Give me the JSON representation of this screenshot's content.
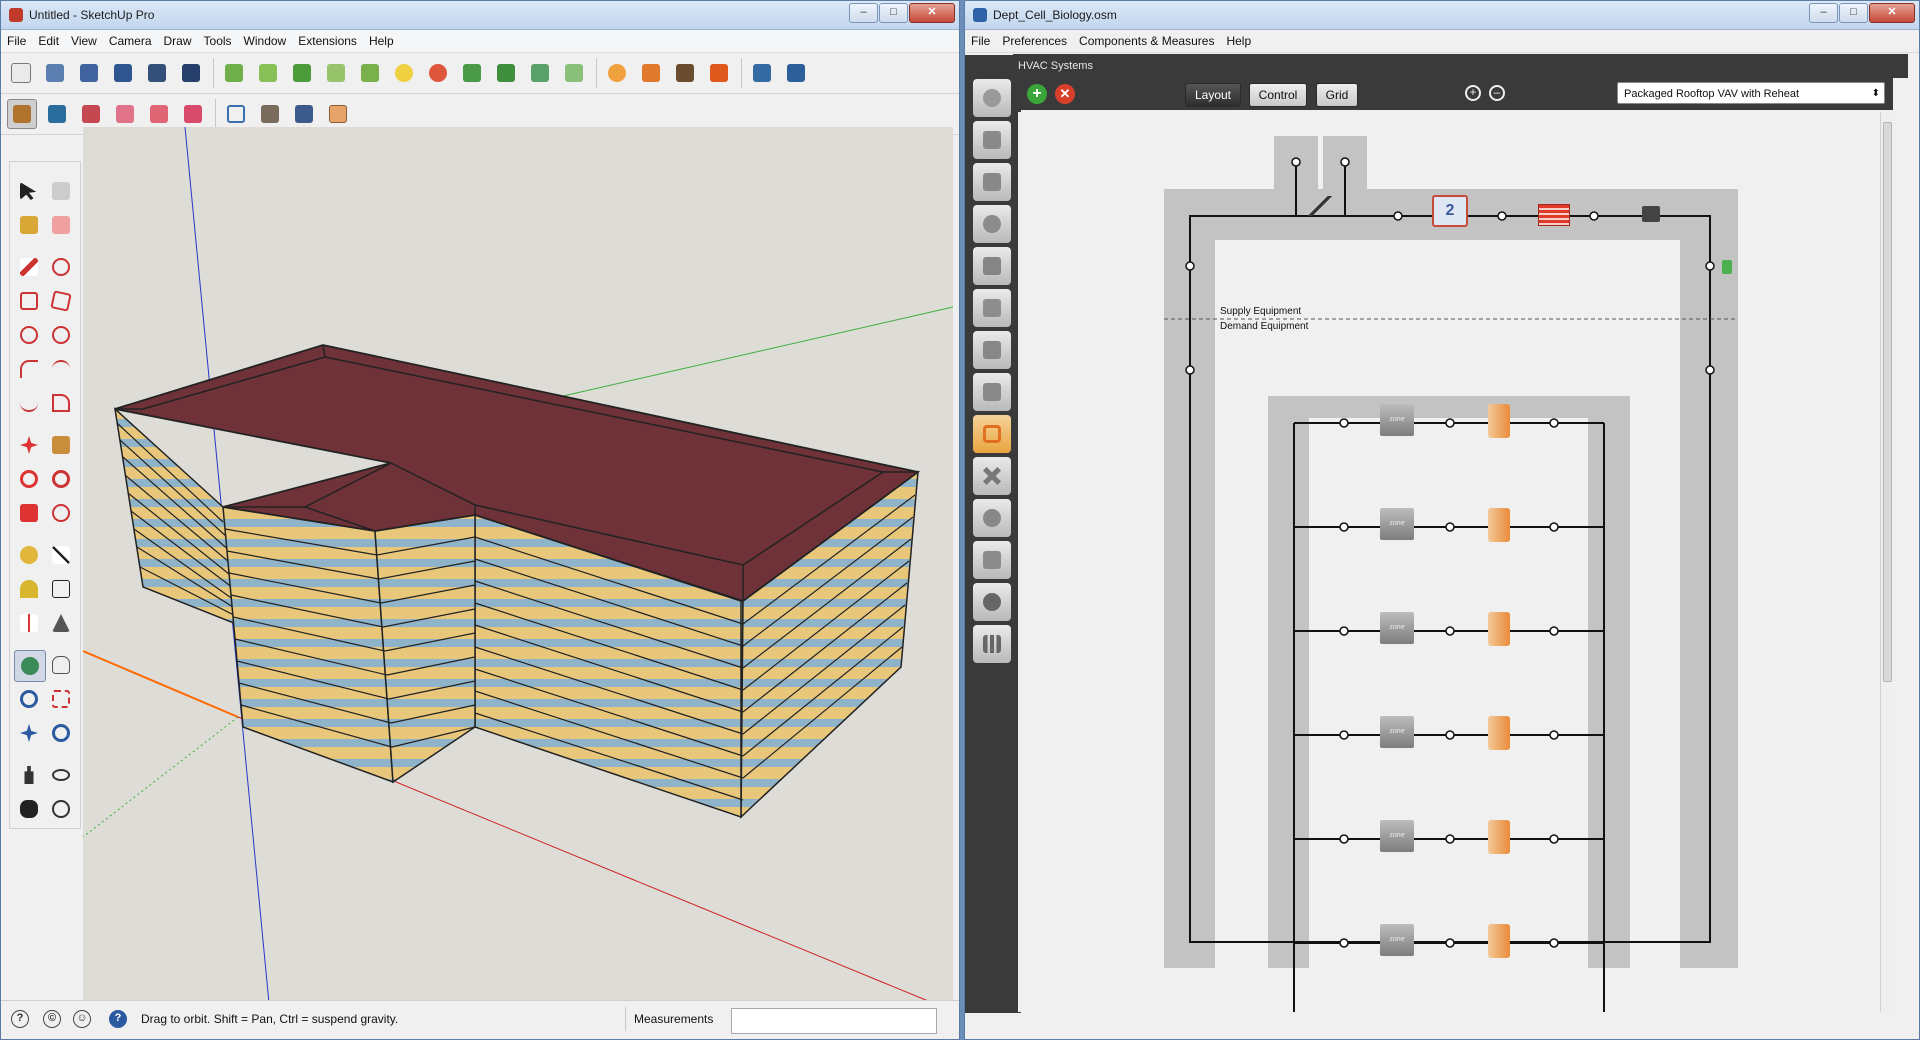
{
  "sketchup": {
    "title": "Untitled - SketchUp Pro",
    "menu": [
      "File",
      "Edit",
      "View",
      "Camera",
      "Draw",
      "Tools",
      "Window",
      "Extensions",
      "Help"
    ],
    "status_message": "Drag to orbit. Shift = Pan, Ctrl = suspend gravity.",
    "measurements_label": "Measurements",
    "measurements_value": "",
    "status_icons": [
      "geo-location-icon",
      "credits-icon",
      "user-account-icon",
      "help-icon"
    ]
  },
  "openstudio": {
    "title": "Dept_Cell_Biology.osm",
    "menu": [
      "File",
      "Preferences",
      "Components & Measures",
      "Help"
    ],
    "section_title": "HVAC Systems",
    "tabs": [
      {
        "label": "Layout",
        "active": true
      },
      {
        "label": "Control",
        "active": false
      },
      {
        "label": "Grid",
        "active": false
      }
    ],
    "system_select": "Packaged Rooftop VAV with Reheat",
    "supply_label": "Supply Equipment",
    "demand_label": "Demand Equipment",
    "zone_label": "zone"
  },
  "window_buttons": {
    "minimize": "–",
    "maximize": "□",
    "close": "✕"
  },
  "colors": {
    "roof": "#6f3238",
    "wall": "#e8c77b",
    "glass": "#8fb3c8",
    "viewport_bg": "#dedcd7",
    "sidebar_dark": "#3a3a3a",
    "loop_gray": "#c3c3c3"
  }
}
